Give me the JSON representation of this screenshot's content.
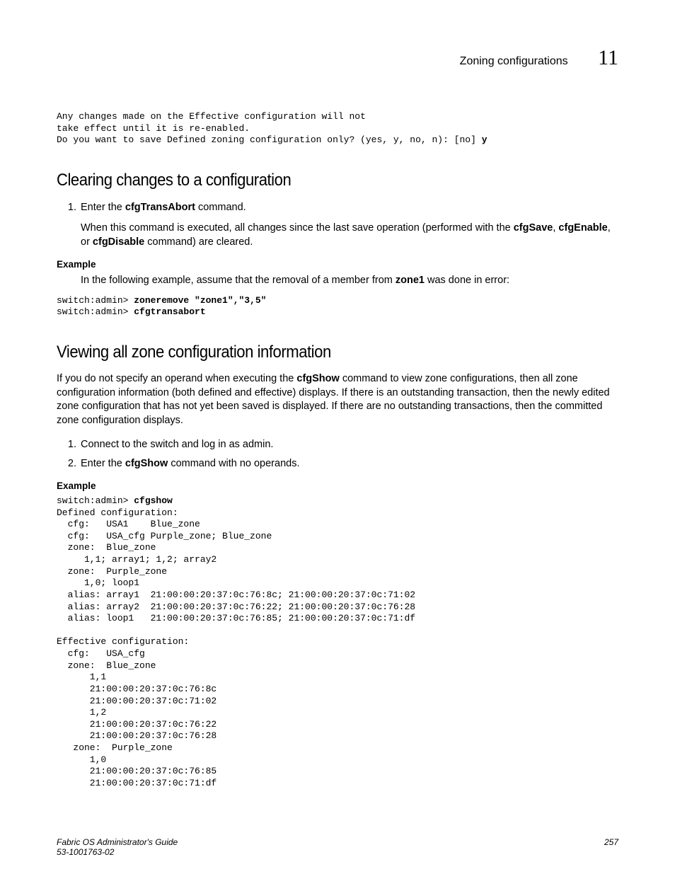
{
  "header": {
    "title": "Zoning configurations",
    "chapter": "11"
  },
  "preBlock": "Any changes made on the Effective configuration will not\ntake effect until it is re-enabled.\nDo you want to save Defined zoning configuration only? (yes, y, no, n): [no] ",
  "preBlockInput": "y",
  "section1": {
    "heading": "Clearing changes to a configuration",
    "step1_pre": "Enter the ",
    "step1_cmd": "cfgTransAbort",
    "step1_post": " command.",
    "step1_body_a": "When this command is executed, all changes since the last save operation (performed with the ",
    "step1_body_b1": "cfgSave",
    "step1_body_c1": ", ",
    "step1_body_b2": "cfgEnable",
    "step1_body_c2": ", or ",
    "step1_body_b3": "cfgDisable",
    "step1_body_c3": " command) are cleared.",
    "exampleLabel": "Example",
    "exampleBody_a": "In the following example, assume that the removal of a member from ",
    "exampleBody_b": "zone1",
    "exampleBody_c": " was done in error:",
    "code_p1": "switch:admin> ",
    "code_c1": "zoneremove \"zone1\",\"3,5\"",
    "code_p2": "switch:admin> ",
    "code_c2": "cfgtransabort"
  },
  "section2": {
    "heading": "Viewing all zone configuration information",
    "intro_a": "If you do not specify an operand when executing the ",
    "intro_b": "cfgShow",
    "intro_c": " command to view zone configurations, then all zone configuration information (both defined and effective) displays. If there is an outstanding transaction, then the newly edited zone configuration that has not yet been saved is displayed. If there are no outstanding transactions, then the committed zone configuration displays.",
    "step1": "Connect to the switch and log in as admin.",
    "step2_a": "Enter the ",
    "step2_b": "cfgShow",
    "step2_c": " command with no operands.",
    "exampleLabel": "Example",
    "code_p1": "switch:admin> ",
    "code_c1": "cfgshow",
    "code_rest": "Defined configuration:\n  cfg:   USA1    Blue_zone\n  cfg:   USA_cfg Purple_zone; Blue_zone\n  zone:  Blue_zone\n     1,1; array1; 1,2; array2\n  zone:  Purple_zone\n     1,0; loop1\n  alias: array1  21:00:00:20:37:0c:76:8c; 21:00:00:20:37:0c:71:02\n  alias: array2  21:00:00:20:37:0c:76:22; 21:00:00:20:37:0c:76:28\n  alias: loop1   21:00:00:20:37:0c:76:85; 21:00:00:20:37:0c:71:df\n\nEffective configuration:\n  cfg:   USA_cfg\n  zone:  Blue_zone\n      1,1\n      21:00:00:20:37:0c:76:8c\n      21:00:00:20:37:0c:71:02\n      1,2\n      21:00:00:20:37:0c:76:22\n      21:00:00:20:37:0c:76:28\n   zone:  Purple_zone\n      1,0\n      21:00:00:20:37:0c:76:85\n      21:00:00:20:37:0c:71:df"
  },
  "footer": {
    "left1": "Fabric OS Administrator's Guide",
    "left2": "53-1001763-02",
    "right": "257"
  }
}
